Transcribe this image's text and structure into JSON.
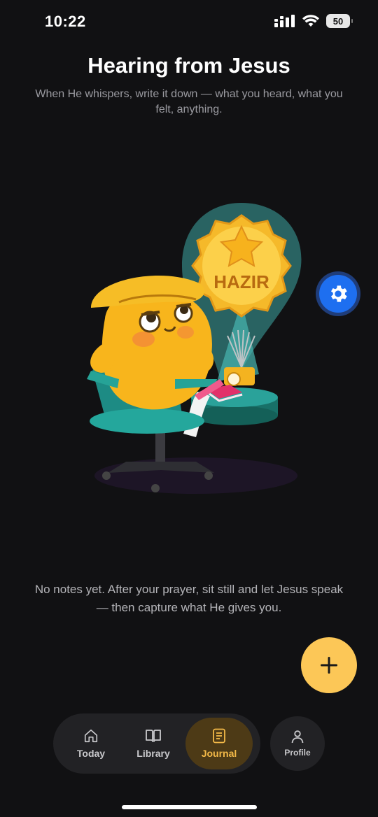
{
  "status_bar": {
    "time": "10:22",
    "battery_level": "50",
    "icons": [
      "cellular-signal-icon",
      "wifi-icon",
      "battery-icon"
    ]
  },
  "header": {
    "title": "Hearing from Jesus",
    "subtitle": "When He whispers, write it down — what you heard, what you felt, anything."
  },
  "illustration": {
    "badge_text": "HAZIR"
  },
  "empty_state": {
    "message": "No notes yet. After your prayer, sit still and let Jesus speak — then capture what He gives you."
  },
  "actions": {
    "settings_icon": "gear-icon",
    "add_icon": "plus-icon"
  },
  "nav": {
    "tabs": [
      {
        "label": "Today",
        "icon": "home-icon",
        "active": false
      },
      {
        "label": "Library",
        "icon": "book-icon",
        "active": false
      },
      {
        "label": "Journal",
        "icon": "document-icon",
        "active": true
      }
    ],
    "profile": {
      "label": "Profile",
      "icon": "person-icon"
    }
  },
  "colors": {
    "background": "#111113",
    "accent": "#fcc757",
    "active_tab_bg": "#4d3a16",
    "active_tab_fg": "#f3b948",
    "settings_blue": "#1e6ff0"
  }
}
